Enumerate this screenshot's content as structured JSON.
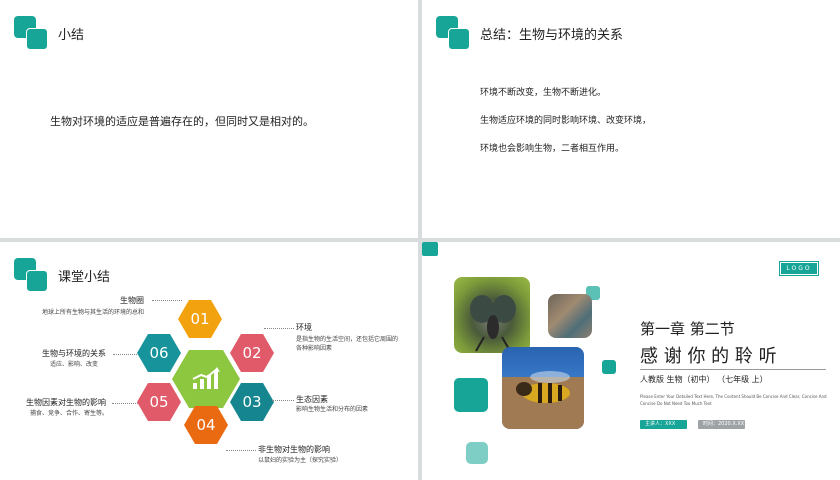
{
  "slide1": {
    "title": "小结",
    "body": "生物对环境的适应是普遍存在的，但同时又是相对的。"
  },
  "slide2": {
    "title": "总结：生物与环境的关系",
    "lines": [
      "环境不断改变，生物不断进化。",
      "生物适应环境的同时影响环境、改变环境，",
      "环境也会影响生物，二者相互作用。"
    ]
  },
  "slide3": {
    "title": "课堂小结",
    "hexes": [
      {
        "num": "01",
        "label": "生物圈",
        "desc": "地球上所有生物与其生活的环境的总和",
        "color": "#f2a10f"
      },
      {
        "num": "02",
        "label": "环境",
        "desc": "是指生物的生活空间，还包括它周围的各种影响因素",
        "color": "#e05a69"
      },
      {
        "num": "03",
        "label": "生态因素",
        "desc": "影响生物生活和分布的因素",
        "color": "#15868f"
      },
      {
        "num": "04",
        "label": "非生物对生物的影响",
        "desc": "以鼠妇的实验为主（探究实验）",
        "color": "#ea6a12"
      },
      {
        "num": "05",
        "label": "生物因素对生物的影响",
        "desc": "捕食、竞争、合作、寄生等。",
        "color": "#e05a69"
      },
      {
        "num": "06",
        "label": "生物与环境的关系",
        "desc": "适应、影响、改变",
        "color": "#17939c"
      }
    ],
    "center_icon": "growth-chart-icon",
    "accent": "#8dc63f"
  },
  "slide4": {
    "logo": "LOGO",
    "chapter": "第一章  第二节",
    "thanks": "感 谢 你 的 聆 听",
    "edition": "人教版  生物（初中）  （七年级 上）",
    "blurb": "Please Enter Your Detailed Text Here, The Content Should Be Concise And Clear, Concise And Concise Do Not Need Too Much Text",
    "presenter": "主讲人：XXX",
    "date": "时间：2020.X.XX",
    "accent": "#16a596"
  }
}
